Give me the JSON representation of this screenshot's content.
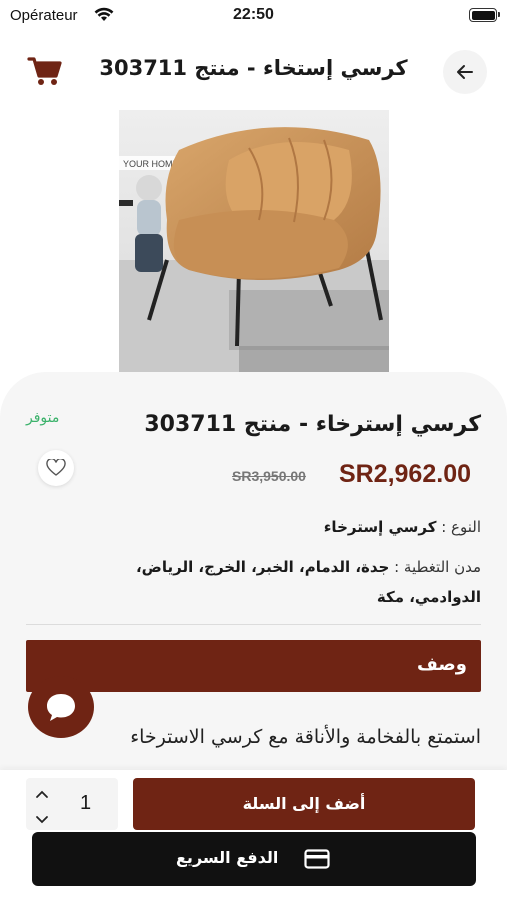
{
  "status_bar": {
    "carrier": "Opérateur",
    "time": "22:50"
  },
  "header": {
    "title": "كرسي إستخاء - منتج 303711",
    "cart_icon": "cart-icon",
    "back_icon": "arrow-left-icon"
  },
  "product": {
    "image_badge": "YOUR HOME",
    "stock_status": "متوفر",
    "title": "كرسي إسترخاء - منتج 303711",
    "price": "SR2,962.00",
    "old_price": "SR3,950.00",
    "type_label": "النوع : ",
    "type_value": "كرسي إسترخاء",
    "cities_label": "مدن التغطية : ",
    "cities_value": "جدة، الدمام، الخبر، الخرج، الرياض، الدوادمي، مكة",
    "favorite_icon": "heart-icon"
  },
  "description": {
    "header": "وصف",
    "text": "استمتع بالفخامة والأناقة مع كرسي الاسترخاء"
  },
  "bottom_bar": {
    "quantity": "1",
    "add_to_cart_label": "أضف إلى السلة",
    "quick_pay_label": "الدفع السريع",
    "quick_pay_icon": "credit-card-icon"
  },
  "colors": {
    "brand": "#6f2414",
    "stock": "#3bb26b",
    "quick_pay_bg": "#111111"
  }
}
